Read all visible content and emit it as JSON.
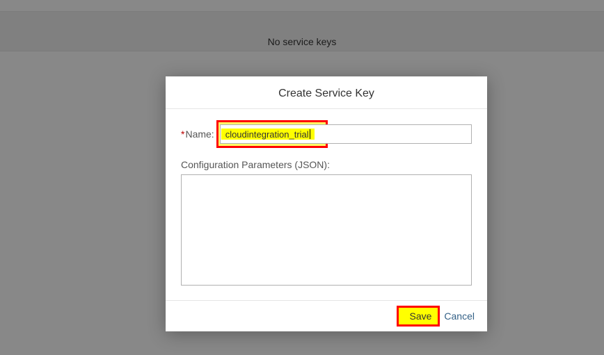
{
  "background": {
    "empty_text": "No service keys"
  },
  "dialog": {
    "title": "Create Service Key",
    "name_label": "Name:",
    "name_value": "cloudintegration_trial",
    "config_label": "Configuration Parameters (JSON):",
    "config_value": "",
    "save_label": "Save",
    "cancel_label": "Cancel"
  }
}
